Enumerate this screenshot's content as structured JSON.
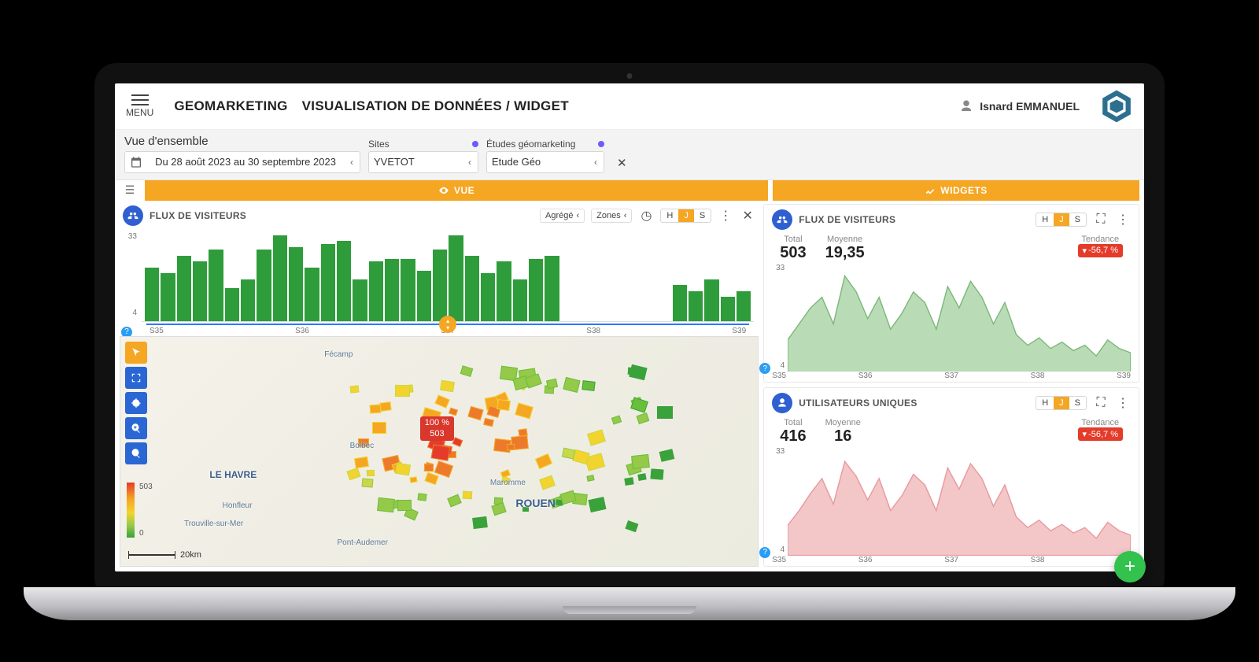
{
  "header": {
    "menu": "MENU",
    "crumb1": "GEOMARKETING",
    "crumb2": "VISUALISATION DE DONNÉES / WIDGET",
    "user": "Isnard EMMANUEL"
  },
  "filters": {
    "view_title": "Vue d'ensemble",
    "date_range": "Du 28 août 2023 au 30 septembre 2023",
    "sites_label": "Sites",
    "sites_value": "YVETOT",
    "etudes_label": "Études géomarketing",
    "etudes_value": "Etude Géo"
  },
  "tabs": {
    "vue": "VUE",
    "widgets": "WIDGETS"
  },
  "flux_panel": {
    "title": "FLUX DE VISITEURS",
    "agg": "Agrégé",
    "zones": "Zones",
    "h": "H",
    "j": "J",
    "s": "S"
  },
  "map": {
    "popup_pct": "100 %",
    "popup_val": "503",
    "legend_max": "503",
    "legend_min": "0",
    "scale": "20km",
    "city1": "LE HAVRE",
    "city2": "ROUEN",
    "city3": "Fécamp",
    "city4": "Bolbec",
    "city5": "Trouville-sur-Mer",
    "city6": "Pont-Audemer",
    "city7": "Maromme",
    "city8": "Honfleur"
  },
  "widget1": {
    "title": "FLUX DE VISITEURS",
    "total_lab": "Total",
    "total_val": "503",
    "moy_lab": "Moyenne",
    "moy_val": "19,35",
    "trend_lab": "Tendance",
    "trend_val": "-56,7 %"
  },
  "widget2": {
    "title": "UTILISATEURS UNIQUES",
    "total_lab": "Total",
    "total_val": "416",
    "moy_lab": "Moyenne",
    "moy_val": "16",
    "trend_lab": "Tendance",
    "trend_val": "-56,7 %"
  },
  "axis": {
    "y_hi": "33",
    "y_lo": "4",
    "s35": "S35",
    "s36": "S36",
    "s37": "S37",
    "s38": "S38",
    "s39": "S39"
  },
  "chart_data": {
    "bar": {
      "type": "bar",
      "ylim": [
        4,
        33
      ],
      "x_weeks": [
        "S35",
        "S36",
        "S37",
        "S38",
        "S39"
      ],
      "values": [
        22,
        20,
        26,
        24,
        28,
        15,
        18,
        28,
        33,
        29,
        22,
        30,
        31,
        18,
        24,
        25,
        25,
        21,
        28,
        33,
        26,
        20,
        24,
        18,
        25,
        26,
        null,
        null,
        null,
        null,
        null,
        null,
        null,
        16,
        14,
        18,
        12,
        14
      ],
      "note": "gaps (null) indicate days with no visible bar"
    },
    "spark1": {
      "type": "area",
      "ylim": [
        4,
        33
      ],
      "x_weeks": [
        "S35",
        "S36",
        "S37",
        "S38",
        "S39"
      ],
      "color": "#9ccf9e"
    },
    "spark2": {
      "type": "area",
      "ylim": [
        4,
        33
      ],
      "x_weeks": [
        "S35",
        "S36",
        "S37",
        "S38",
        "S39"
      ],
      "color": "#f1b4b6"
    }
  }
}
